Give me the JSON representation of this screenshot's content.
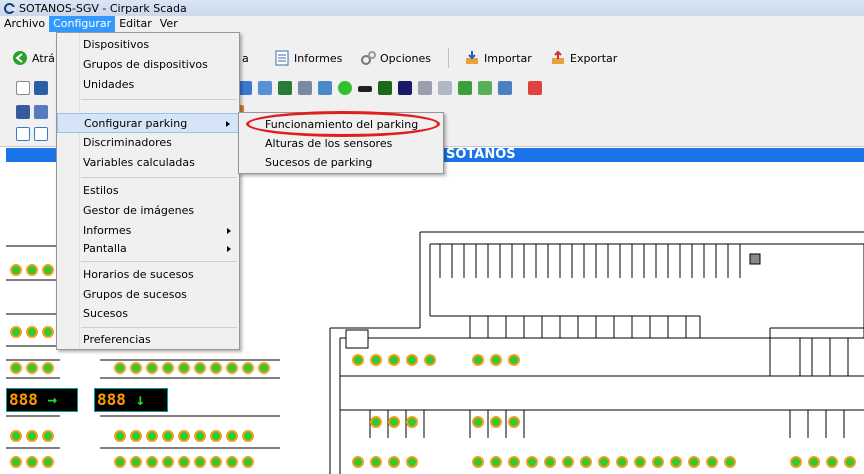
{
  "window": {
    "title": "SOTANOS-SGV - Cirpark Scada"
  },
  "menubar": {
    "items": [
      "Archivo",
      "Configurar",
      "Editar",
      "Ver"
    ]
  },
  "toolbar": {
    "back_label": "Atrá",
    "partial_label": "a",
    "informes_label": "Informes",
    "opciones_label": "Opciones",
    "importar_label": "Importar",
    "exportar_label": "Exportar"
  },
  "configurar_menu": {
    "items": [
      "Dispositivos",
      "Grupos de dispositivos",
      "Unidades",
      "Configurar parking",
      "Discriminadores",
      "Variables calculadas",
      "Estilos",
      "Gestor de imágenes",
      "Informes",
      "Pantalla",
      "Horarios de sucesos",
      "Grupos de sucesos",
      "Sucesos",
      "Preferencias"
    ]
  },
  "submenu": {
    "items": [
      "Funcionamiento del parking",
      "Alturas de los sensores",
      "Sucesos de parking"
    ]
  },
  "canvas": {
    "header": "SOTANOS"
  },
  "displays": [
    {
      "digits": "888",
      "arrow": "→"
    },
    {
      "digits": "888",
      "arrow": "↓"
    }
  ],
  "colors": {
    "accent": "#3399ff",
    "header_blue": "#1b73e8",
    "oval_red": "#e0201c"
  }
}
